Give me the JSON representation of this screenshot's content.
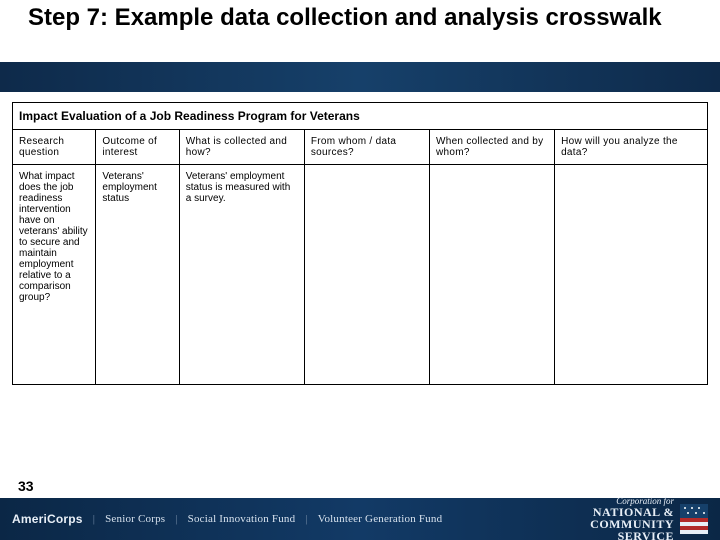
{
  "title": "Step 7: Example data collection and analysis crosswalk",
  "table": {
    "caption": "Impact Evaluation of a Job Readiness Program for Veterans",
    "headers": [
      "Research question",
      "Outcome of interest",
      "What is collected and how?",
      "From whom / data sources?",
      "When collected and by whom?",
      "How will you analyze the data?"
    ],
    "row": {
      "research_question": "What impact does the job readiness intervention have on veterans' ability to secure and maintain employment relative to a comparison group?",
      "outcome_of_interest": "Veterans' employment status",
      "what_collected": "Veterans' employment status is measured with a survey.",
      "from_whom": "",
      "when_collected": "",
      "analyze": ""
    }
  },
  "page_number": "33",
  "footer": {
    "americorps": "AmeriCorps",
    "programs": [
      "Senior Corps",
      "Social Innovation Fund",
      "Volunteer Generation Fund"
    ],
    "brand": {
      "line1": "Corporation for",
      "line2": "NATIONAL &",
      "line3": "COMMUNITY",
      "line4": "SERVICE"
    }
  }
}
